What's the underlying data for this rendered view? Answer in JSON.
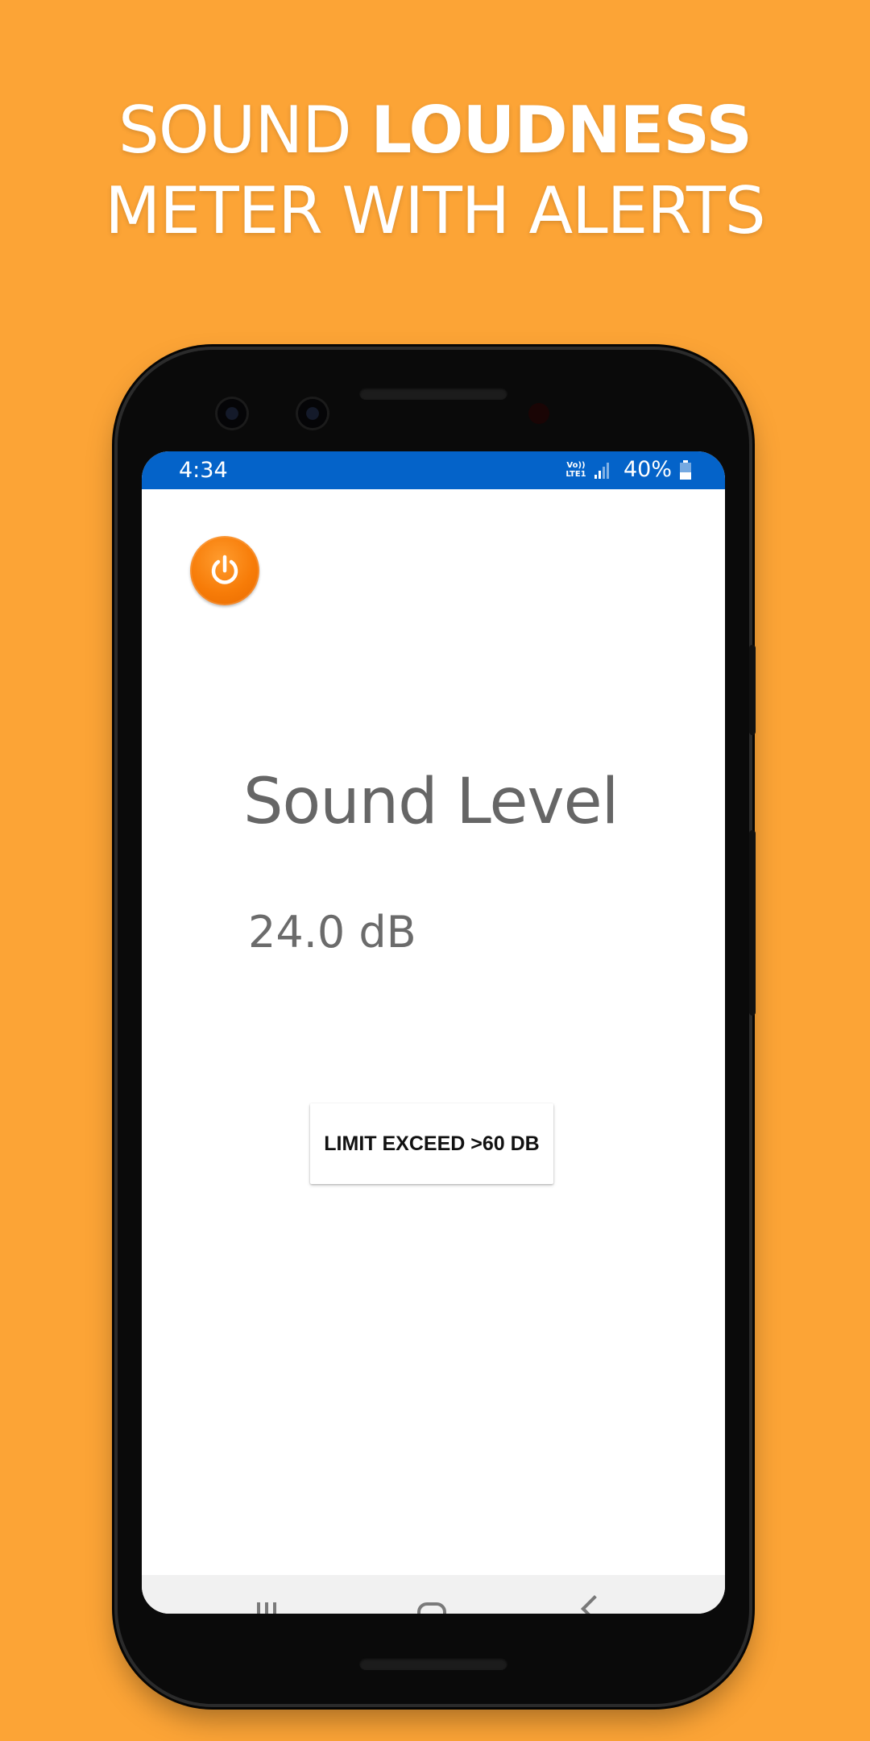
{
  "promo": {
    "headline_part1": "SOUND ",
    "headline_part2_bold": "LOUDNESS",
    "headline_line2": "METER WITH ALERTS"
  },
  "status_bar": {
    "time": "4:34",
    "network_line1": "Vo))",
    "network_line2": "LTE1",
    "battery": "40%"
  },
  "power_button": {
    "icon": "power-icon"
  },
  "main": {
    "title": "Sound Level",
    "value": "24.0 dB",
    "limit_button_label": "LIMIT EXCEED >60 DB"
  },
  "colors": {
    "background": "#FCA436",
    "status_bar": "#0463C9",
    "power_button": "#F77C08",
    "text_gray": "#666666"
  }
}
